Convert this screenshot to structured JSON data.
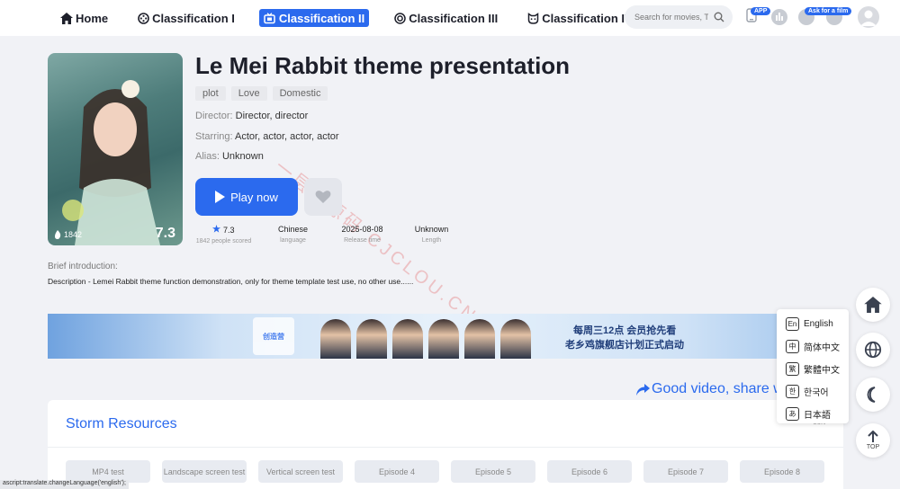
{
  "nav": {
    "items": [
      {
        "label": "Home",
        "icon": "home-icon"
      },
      {
        "label": "Classification I",
        "icon": "film-reel-icon"
      },
      {
        "label": "Classification II",
        "icon": "tv-icon",
        "active": true
      },
      {
        "label": "Classification III",
        "icon": "target-icon"
      },
      {
        "label": "Classification IV",
        "icon": "cat-face-icon"
      }
    ]
  },
  "search": {
    "placeholder": "Search for movies, T"
  },
  "header": {
    "app_badge": "APP",
    "ask_badge": "Ask for a film"
  },
  "movie": {
    "title": "Le Mei Rabbit theme presentation",
    "tags": [
      "plot",
      "Love",
      "Domestic"
    ],
    "director_key": "Director:",
    "director": "Director, director",
    "starring_key": "Starring:",
    "starring": "Actor, actor, actor, actor",
    "alias_key": "Alias:",
    "alias": "Unknown",
    "views": "1842",
    "score": "7.3",
    "play_label": "Play now",
    "stats": [
      {
        "value": "7.3",
        "label": "1842 people scored"
      },
      {
        "value": "Chinese",
        "label": "language"
      },
      {
        "value": "2025-08-08",
        "label": "Release time"
      },
      {
        "value": "Unknown",
        "label": "Length"
      }
    ],
    "brief_label": "Brief introduction:",
    "brief_text": "Description - Lemei Rabbit theme function demonstration, only for theme template test use, no other use......"
  },
  "watermark": "一层楼源码 CJCLOU.CN",
  "banner": {
    "line1": "每周三12点 会员抢先看",
    "line2": "老乡鸡旗舰店计划正式启动",
    "logo": "创造营"
  },
  "share_label": "Good video, share w",
  "resources": {
    "title": "Storm Resources",
    "sort_label": "sort",
    "episodes": [
      "MP4 test",
      "Landscape screen test",
      "Vertical screen test",
      "Episode 4",
      "Episode 5",
      "Episode 6",
      "Episode 7",
      "Episode 8"
    ]
  },
  "language_menu": [
    {
      "icon": "En",
      "label": "English"
    },
    {
      "icon": "中",
      "label": "简体中文"
    },
    {
      "icon": "繁",
      "label": "繁體中文"
    },
    {
      "icon": "한",
      "label": "한국어"
    },
    {
      "icon": "あ",
      "label": "日本語"
    }
  ],
  "status_bar": "ascript:translate.changeLanguage('english');",
  "fab": {
    "top_label": "TOP"
  },
  "colors": {
    "accent": "#2b6aee",
    "background": "#f1f2f6"
  }
}
